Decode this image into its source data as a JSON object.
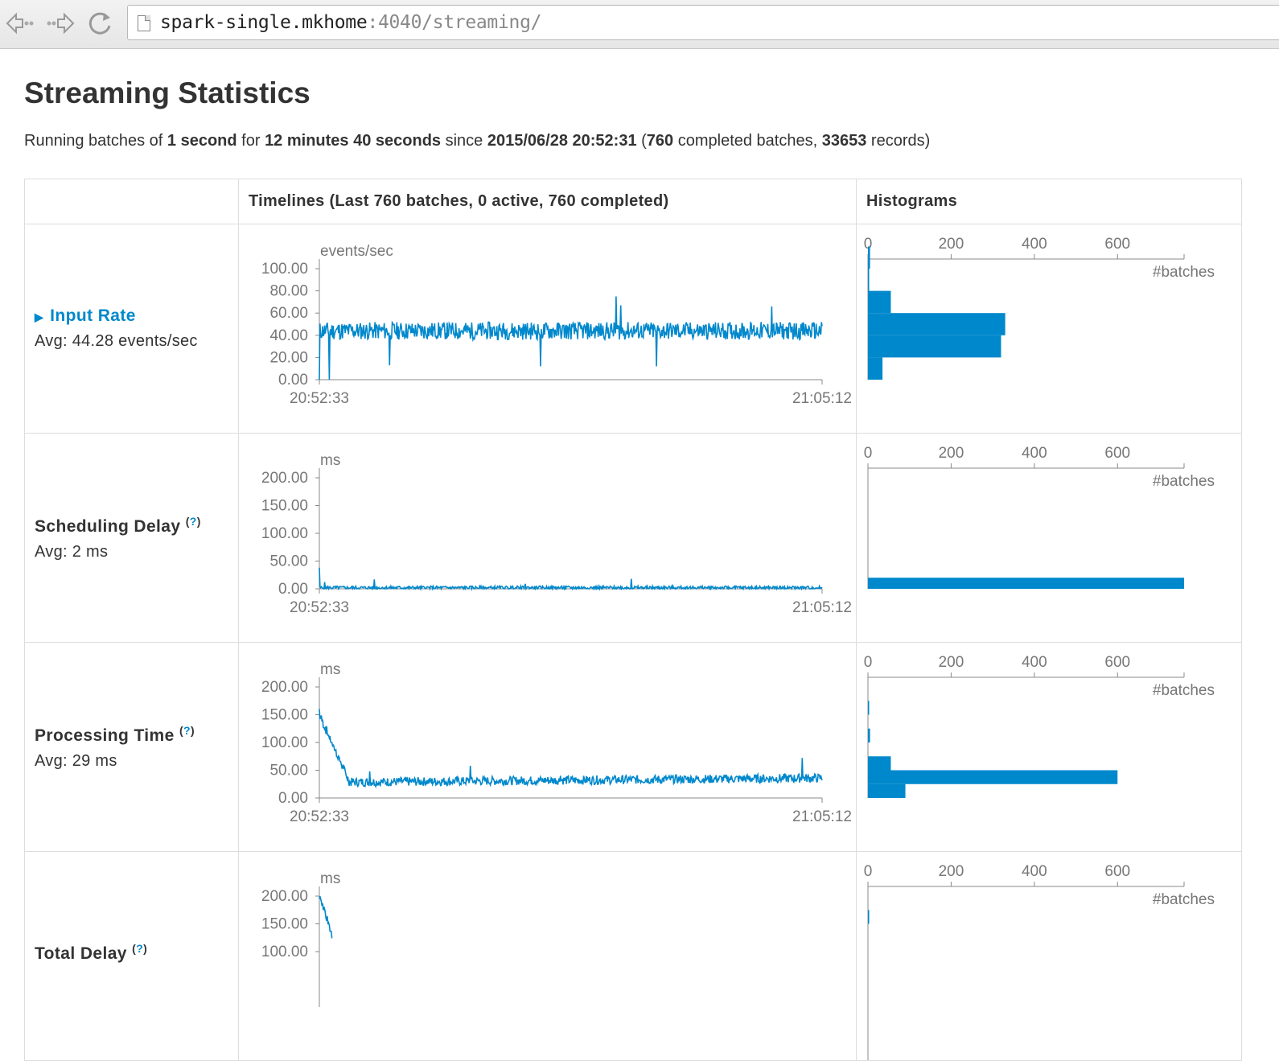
{
  "browser": {
    "url_host": "spark-single.mkhome",
    "url_rest": ":4040/streaming/",
    "back_icon": "back-arrow-icon",
    "forward_icon": "forward-arrow-icon",
    "reload_icon": "reload-icon"
  },
  "page": {
    "title": "Streaming Statistics",
    "summary": {
      "p1": "Running batches of ",
      "batch_interval": "1 second",
      "p2": " for ",
      "duration": "12 minutes 40 seconds",
      "p3": " since ",
      "start_time": "2015/06/28 20:52:31",
      "p4": " (",
      "completed_batches": "760",
      "p5": " completed batches, ",
      "records": "33653",
      "p6": " records)"
    }
  },
  "table": {
    "headers": [
      "",
      "Timelines (Last 760 batches, 0 active, 760 completed)",
      "Histograms"
    ]
  },
  "metrics": [
    {
      "name": "Input Rate",
      "avg": "Avg: 44.28 events/sec",
      "has_arrow": true,
      "help": ""
    },
    {
      "name": "Scheduling Delay",
      "avg": "Avg: 2 ms",
      "has_arrow": false,
      "help": "?"
    },
    {
      "name": "Processing Time",
      "avg": "Avg: 29 ms",
      "has_arrow": false,
      "help": "?"
    },
    {
      "name": "Total Delay",
      "avg": "",
      "has_arrow": false,
      "help": "?"
    }
  ],
  "chart_data": [
    {
      "type": "line",
      "unit": "events/sec",
      "yticks": [
        "100.00",
        "80.00",
        "60.00",
        "40.00",
        "20.00",
        "0.00"
      ],
      "ylim": [
        0,
        100
      ],
      "x_start": "20:52:33",
      "x_end": "21:05:12",
      "baseline": 44,
      "noise": 8,
      "seed": 11,
      "spikes": [
        [
          0.14,
          90
        ],
        [
          0.14,
          13
        ],
        [
          0.44,
          73
        ],
        [
          0.44,
          12
        ],
        [
          0.59,
          75
        ],
        [
          0.6,
          67
        ],
        [
          0.67,
          110
        ],
        [
          0.67,
          12
        ],
        [
          0.02,
          0
        ],
        [
          0.9,
          66
        ]
      ],
      "color": "#0088cc"
    },
    {
      "type": "line",
      "unit": "ms",
      "yticks": [
        "200.00",
        "150.00",
        "100.00",
        "50.00",
        "0.00"
      ],
      "ylim": [
        0,
        200
      ],
      "x_start": "20:52:33",
      "x_end": "21:05:12",
      "baseline": 2,
      "noise": 3,
      "seed": 5,
      "spikes": [
        [
          0.0,
          38
        ],
        [
          0.01,
          12
        ],
        [
          0.11,
          17
        ],
        [
          0.41,
          9
        ],
        [
          0.62,
          18
        ]
      ],
      "color": "#0088cc"
    },
    {
      "type": "line",
      "unit": "ms",
      "yticks": [
        "200.00",
        "150.00",
        "100.00",
        "50.00",
        "0.00"
      ],
      "ylim": [
        0,
        200
      ],
      "x_start": "20:52:33",
      "x_end": "21:05:12",
      "baseline": 28,
      "noise": 8,
      "seed": 7,
      "decay_from": 150,
      "decay_len": 0.06,
      "trend_end": 36,
      "spikes": [
        [
          0.0,
          160
        ],
        [
          0.1,
          48
        ],
        [
          0.3,
          58
        ],
        [
          0.48,
          40
        ],
        [
          0.96,
          72
        ]
      ],
      "color": "#0088cc"
    },
    {
      "type": "line",
      "unit": "ms",
      "yticks": [
        "200.00",
        "150.00",
        "100.00"
      ],
      "ylim": [
        0,
        200
      ],
      "x_start": "",
      "x_end": "",
      "baseline": 30,
      "noise": 8,
      "seed": 9,
      "decay_from": 200,
      "decay_len": 0.06,
      "spikes": [],
      "color": "#0088cc",
      "partial": true
    }
  ],
  "histograms": [
    {
      "xticks": [
        "0",
        "200",
        "400",
        "600"
      ],
      "xlabel": "#batches",
      "bins": [
        [
          100,
          5
        ],
        [
          80,
          2
        ],
        [
          60,
          55
        ],
        [
          40,
          330
        ],
        [
          20,
          320
        ],
        [
          0,
          35
        ]
      ],
      "binsize": 20
    },
    {
      "xticks": [
        "0",
        "200",
        "400",
        "600"
      ],
      "xlabel": "#batches",
      "bins": [
        [
          0,
          760
        ]
      ],
      "binsize": 20
    },
    {
      "xticks": [
        "0",
        "200",
        "400",
        "600"
      ],
      "xlabel": "#batches",
      "bins": [
        [
          150,
          2
        ],
        [
          100,
          5
        ],
        [
          50,
          55
        ],
        [
          25,
          600
        ],
        [
          0,
          90
        ]
      ],
      "binsize": 25
    },
    {
      "xticks": [
        "0",
        "200",
        "400",
        "600"
      ],
      "xlabel": "#batches",
      "bins": [
        [
          150,
          3
        ]
      ],
      "binsize": 25
    }
  ]
}
